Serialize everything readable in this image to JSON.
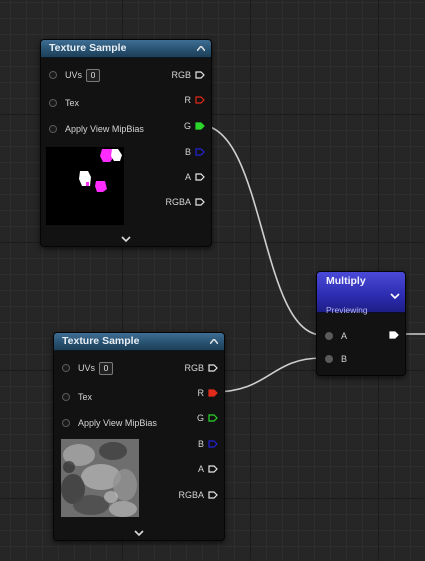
{
  "nodes": {
    "texture_sample_1": {
      "title": "Texture Sample",
      "inputs": {
        "uvs": "UVs",
        "uvs_value": "0",
        "tex": "Tex",
        "mip": "Apply View MipBias"
      },
      "outputs": {
        "rgb": "RGB",
        "r": "R",
        "g": "G",
        "b": "B",
        "a": "A",
        "rgba": "RGBA"
      }
    },
    "texture_sample_2": {
      "title": "Texture Sample",
      "inputs": {
        "uvs": "UVs",
        "uvs_value": "0",
        "tex": "Tex",
        "mip": "Apply View MipBias"
      },
      "outputs": {
        "rgb": "RGB",
        "r": "R",
        "g": "G",
        "b": "B",
        "a": "A",
        "rgba": "RGBA"
      }
    },
    "multiply": {
      "title": "Multiply",
      "subtitle": "Previewing",
      "inputs": {
        "a": "A",
        "b": "B"
      }
    }
  },
  "colors": {
    "pin_r": "#e02a1a",
    "pin_g": "#2bd62b",
    "pin_b": "#2323d8",
    "pin_white": "#e6e6e6",
    "wire": "#cfcfcf"
  },
  "icons": [
    "collapse-chevron-icon",
    "expand-chevron-icon",
    "output-pin-icon",
    "input-pin-icon"
  ]
}
